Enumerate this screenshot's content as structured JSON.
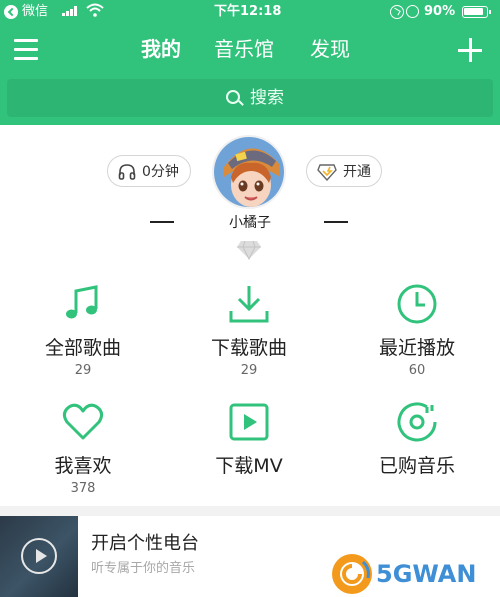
{
  "status_bar": {
    "carrier": "微信",
    "time": "下午12:18",
    "battery": "90%"
  },
  "nav": {
    "tabs": [
      "我的",
      "音乐馆",
      "发现"
    ],
    "active_tab": "我的"
  },
  "search": {
    "placeholder": "搜索"
  },
  "profile": {
    "listen_time": "0分钟",
    "vip_button": "开通",
    "username": "小橘子"
  },
  "grid": [
    {
      "label": "全部歌曲",
      "count": "29",
      "icon": "music-note-icon"
    },
    {
      "label": "下载歌曲",
      "count": "29",
      "icon": "download-icon"
    },
    {
      "label": "最近播放",
      "count": "60",
      "icon": "clock-icon"
    },
    {
      "label": "我喜欢",
      "count": "378",
      "icon": "heart-icon"
    },
    {
      "label": "下载MV",
      "count": "",
      "icon": "video-icon"
    },
    {
      "label": "已购音乐",
      "count": "",
      "icon": "disc-icon"
    }
  ],
  "radio": {
    "title": "开启个性电台",
    "subtitle": "听专属于你的音乐"
  },
  "watermark": {
    "text": "5GWAN"
  },
  "colors": {
    "brand_green": "#31c27c",
    "watermark_orange": "#f39a1d",
    "watermark_blue": "#3f8fd6"
  }
}
